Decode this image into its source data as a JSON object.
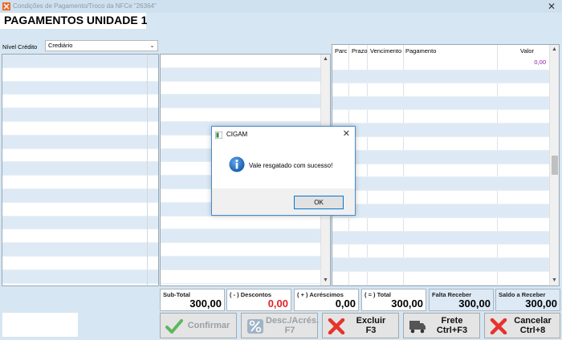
{
  "window": {
    "title": "Condições de Pagamento/Troco da NFCe \"26364\"",
    "close": "✕"
  },
  "page_title": "PAGAMENTOS UNIDADE 1",
  "nivel_credito": {
    "label": "Nível Crédito",
    "value": "Crediário"
  },
  "payments_grid": {
    "columns": [
      "Parc",
      "Prazo",
      "Vencimento",
      "Pagamento",
      "Valor"
    ],
    "total_value": "0,00"
  },
  "totals": [
    {
      "label": "Sub-Total",
      "value": "300,00"
    },
    {
      "label": "( - ) Descontos",
      "value": "0,00"
    },
    {
      "label": "( + ) Acréscimos",
      "value": "0,00"
    },
    {
      "label": "( = ) Total",
      "value": "300,00"
    },
    {
      "label": "Falta Receber",
      "value": "300,00"
    },
    {
      "label": "Saldo a Receber",
      "value": "300,00"
    }
  ],
  "buttons": {
    "confirmar": "Confirmar",
    "desc_line1": "Desc./Acrés.",
    "desc_line2": "F7",
    "excluir_line1": "Excluir",
    "excluir_line2": "F3",
    "frete_line1": "Frete",
    "frete_line2": "Ctrl+F3",
    "cancelar_line1": "Cancelar",
    "cancelar_line2": "Ctrl+8"
  },
  "dialog": {
    "title": "CIGAM",
    "message": "Vale resgatado com sucesso!",
    "ok": "OK",
    "close": "✕"
  },
  "colors": {
    "accent_blue": "#0078d7",
    "negative_red": "#e0202a",
    "value_purple": "#8a1bb0"
  }
}
